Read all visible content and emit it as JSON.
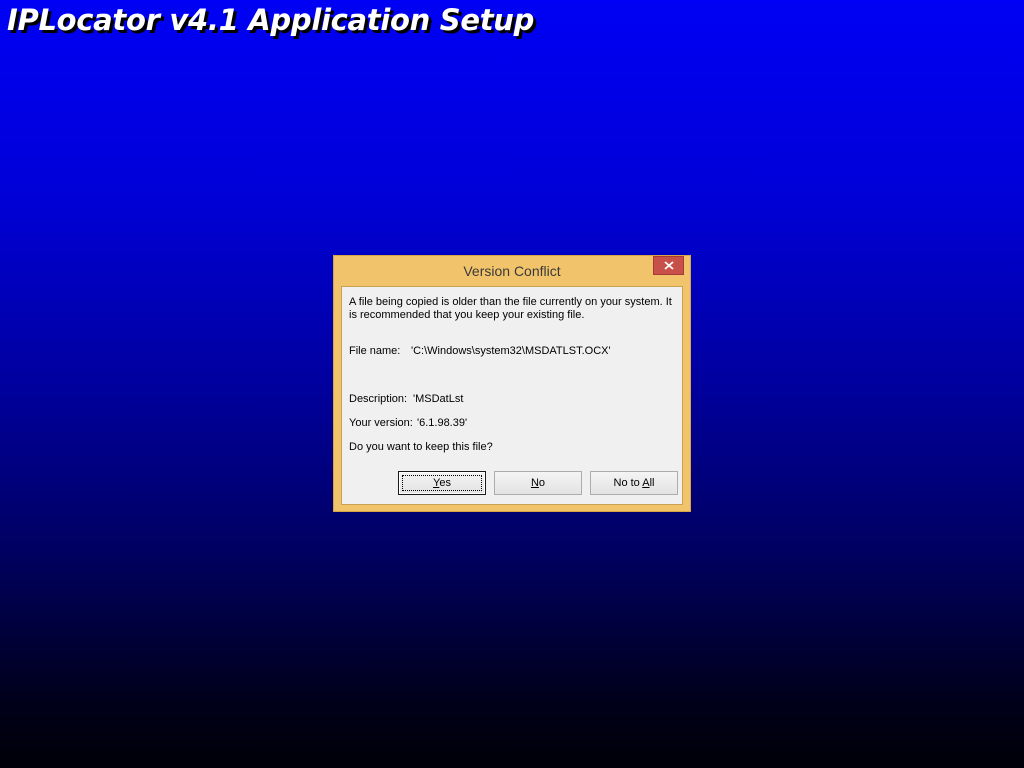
{
  "window": {
    "title": "IPLocator v4.1 Application Setup"
  },
  "dialog": {
    "title": "Version Conflict",
    "close_icon": "close-icon",
    "intro_line1": "A file being copied is older than the file currently on your system.  It",
    "intro_line2": "is recommended that you keep your existing file.",
    "file_name_label": "File name:",
    "file_name_value": "'C:\\Windows\\system32\\MSDATLST.OCX'",
    "description_label": "Description:",
    "description_value": "'MSDatLst",
    "version_label": "Your version:",
    "version_value": "'6.1.98.39'",
    "question": "Do you want to keep this file?"
  },
  "buttons": {
    "yes": {
      "pre": "",
      "mnemonic": "Y",
      "post": "es"
    },
    "no": {
      "pre": "",
      "mnemonic": "N",
      "post": "o"
    },
    "no_to_all": {
      "pre": "No to ",
      "mnemonic": "A",
      "post": "ll"
    }
  },
  "colors": {
    "background_top": "#0000f4",
    "background_bottom": "#000008",
    "dialog_frame": "#f1c46b",
    "close_button": "#c7504a"
  }
}
